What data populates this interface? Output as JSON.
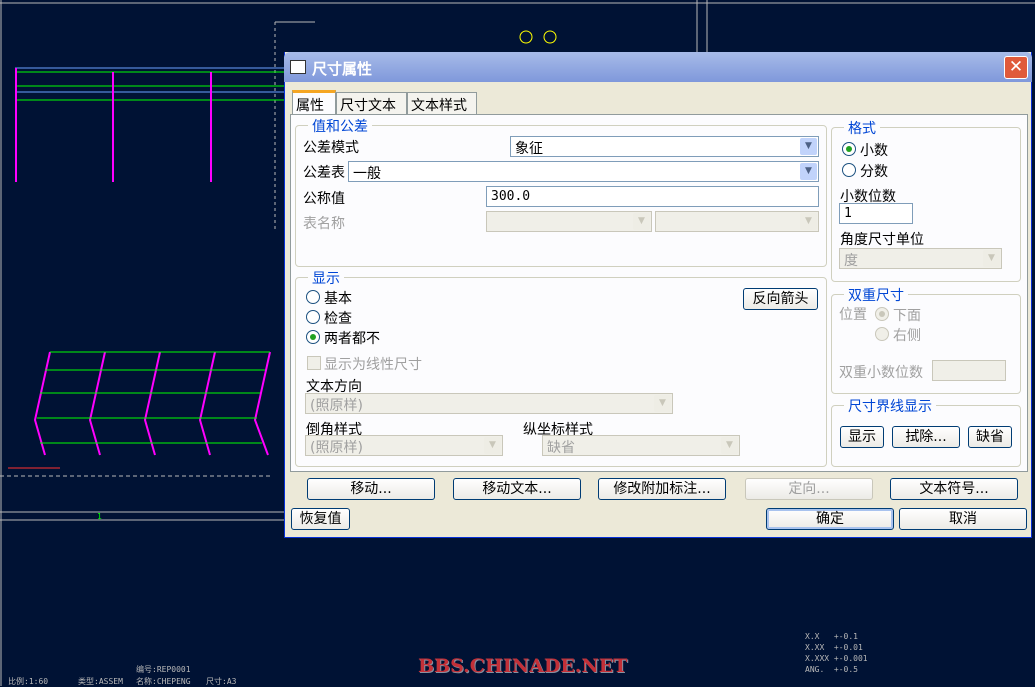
{
  "dialog": {
    "title": "尺寸属性",
    "close": "✕"
  },
  "tabs": [
    "属性",
    "尺寸文本",
    "文本样式"
  ],
  "value_tolerance": {
    "title": "值和公差",
    "tol_mode_label": "公差模式",
    "tol_mode": "象征",
    "tol_table_label": "公差表",
    "tol_table": "一般",
    "nominal_label": "公称值",
    "nominal": "300.0",
    "table_name_label": "表名称"
  },
  "format": {
    "title": "格式",
    "decimal": "小数",
    "fraction": "分数",
    "decimals_label": "小数位数",
    "decimals": "1",
    "angle_unit_label": "角度尺寸单位",
    "angle_unit": "度"
  },
  "display": {
    "title": "显示",
    "basic": "基本",
    "inspect": "检查",
    "neither": "两者都不",
    "flip_arrows": "反向箭头",
    "show_linear": "显示为线性尺寸",
    "text_orient_label": "文本方向",
    "text_orient": "(照原样)",
    "chamfer_label": "倒角样式",
    "chamfer": "(照原样)",
    "ordinate_label": "纵坐标样式",
    "ordinate": "缺省"
  },
  "dual": {
    "title": "双重尺寸",
    "position_label": "位置",
    "below": "下面",
    "right": "右侧",
    "decimals_label": "双重小数位数"
  },
  "witness": {
    "title": "尺寸界线显示",
    "show": "显示",
    "erase": "拭除...",
    "default": "缺省"
  },
  "actions": {
    "move": "移动...",
    "move_text": "移动文本...",
    "modify_attach": "修改附加标注...",
    "orient": "定向...",
    "text_symbol": "文本符号...",
    "restore": "恢复值",
    "ok": "确定",
    "cancel": "取消"
  },
  "cad": {
    "tol1": "X.X   +-0.1",
    "tol2": "X.XX  +-0.01",
    "tol3": "X.XXX +-0.001",
    "tol4": "ANG.  +-0.5",
    "number": "编号:REP0001",
    "scale": "比例:1:60",
    "type": "类型:ASSEM",
    "name": "名称:CHEPENG",
    "size": "尺寸:A3",
    "dim": "1",
    "watermark": "BBS.CHINADE.NET"
  }
}
